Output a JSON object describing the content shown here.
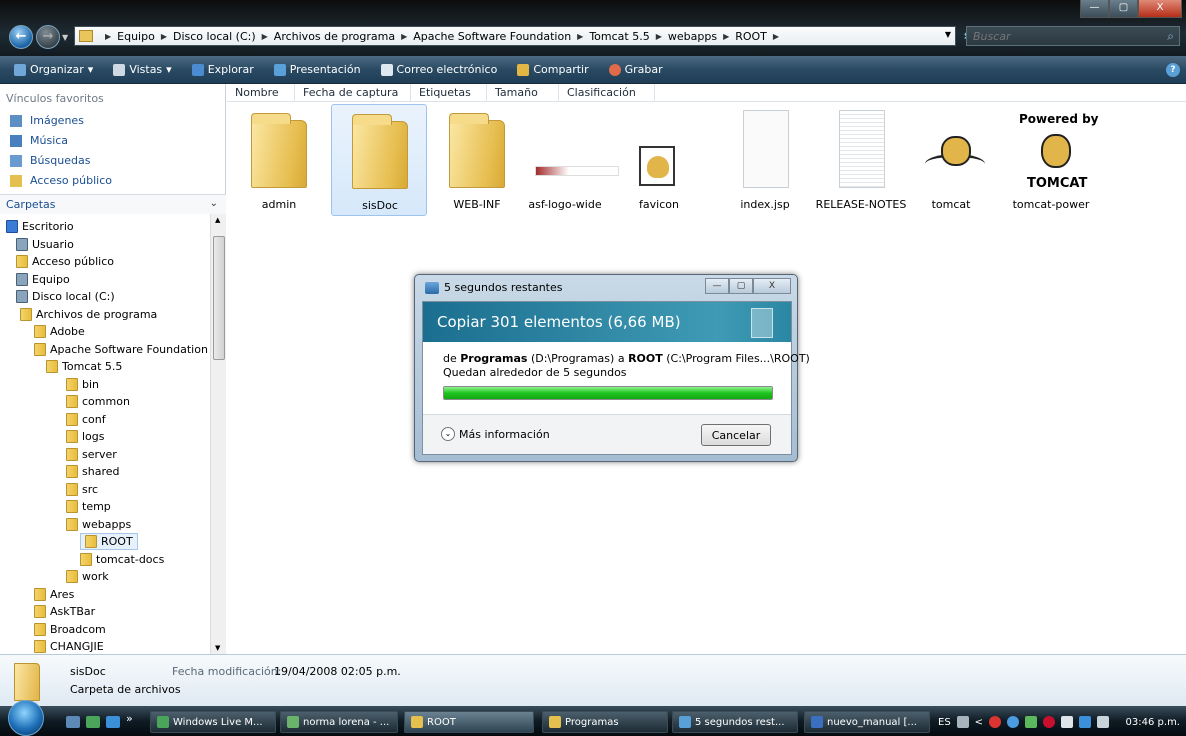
{
  "window": {
    "controls": {
      "minimize": "—",
      "maximize": "▢",
      "close": "X"
    }
  },
  "address": {
    "crumbs": [
      "Equipo",
      "Disco local (C:)",
      "Archivos de programa",
      "Apache Software Foundation",
      "Tomcat 5.5",
      "webapps",
      "ROOT"
    ],
    "search_placeholder": "Buscar"
  },
  "toolbar": {
    "organize": "Organizar",
    "views": "Vistas",
    "explore": "Explorar",
    "presentation": "Presentación",
    "email": "Correo electrónico",
    "share": "Compartir",
    "burn": "Grabar",
    "help": "?"
  },
  "sidebar": {
    "favorites_title": "Vínculos favoritos",
    "favorites": [
      "Imágenes",
      "Música",
      "Búsquedas",
      "Acceso público"
    ],
    "folders_title": "Carpetas",
    "tree": [
      {
        "label": "Escritorio",
        "level": 0
      },
      {
        "label": "Usuario",
        "level": 1
      },
      {
        "label": "Acceso público",
        "level": 1
      },
      {
        "label": "Equipo",
        "level": 1
      },
      {
        "label": "Disco local (C:)",
        "level": 2
      },
      {
        "label": "Archivos de programa",
        "level": 3
      },
      {
        "label": "Adobe",
        "level": 4
      },
      {
        "label": "Apache Software Foundation",
        "level": 4
      },
      {
        "label": "Tomcat 5.5",
        "level": 5
      },
      {
        "label": "bin",
        "level": 6
      },
      {
        "label": "common",
        "level": 6
      },
      {
        "label": "conf",
        "level": 6
      },
      {
        "label": "logs",
        "level": 6
      },
      {
        "label": "server",
        "level": 6
      },
      {
        "label": "shared",
        "level": 6
      },
      {
        "label": "src",
        "level": 6
      },
      {
        "label": "temp",
        "level": 6
      },
      {
        "label": "webapps",
        "level": 6
      },
      {
        "label": "ROOT",
        "level": 7
      },
      {
        "label": "tomcat-docs",
        "level": 7
      },
      {
        "label": "work",
        "level": 6
      },
      {
        "label": "Ares",
        "level": 4
      },
      {
        "label": "AskTBar",
        "level": 4
      },
      {
        "label": "Broadcom",
        "level": 4
      },
      {
        "label": "CHANGJIE",
        "level": 4
      }
    ]
  },
  "columns": [
    "Nombre",
    "Fecha de captura",
    "Etiquetas",
    "Tamaño",
    "Clasificación"
  ],
  "files": [
    "admin",
    "sisDoc",
    "WEB-INF",
    "asf-logo-wide",
    "favicon",
    "index.jsp",
    "RELEASE-NOTES",
    "tomcat",
    "tomcat-power"
  ],
  "thumb_text": {
    "powered_by": "Powered by",
    "tomcat": "TOMCAT"
  },
  "dialog": {
    "title": "5 segundos restantes",
    "heading": "Copiar 301 elementos (6,66 MB)",
    "from_prefix": "de",
    "from_name": "Programas",
    "from_path": "(D:\\Programas)",
    "to_prefix": "a",
    "to_name": "ROOT",
    "to_path": "(C:\\Program Files...\\ROOT)",
    "remaining": "Quedan alrededor de 5 segundos",
    "progress_percent": 100,
    "more_info": "Más información",
    "cancel": "Cancelar"
  },
  "details": {
    "name": "sisDoc",
    "type": "Carpeta de archivos",
    "date_label": "Fecha modificación:",
    "date_value": "19/04/2008 02:05 p.m."
  },
  "taskbar": {
    "tasks": [
      "Windows Live M...",
      "norma lorena - ...",
      "ROOT",
      "Programas",
      "5 segundos rest...",
      "nuevo_manual [..."
    ],
    "lang": "ES",
    "clock": "03:46 p.m.",
    "chevron": "»"
  }
}
